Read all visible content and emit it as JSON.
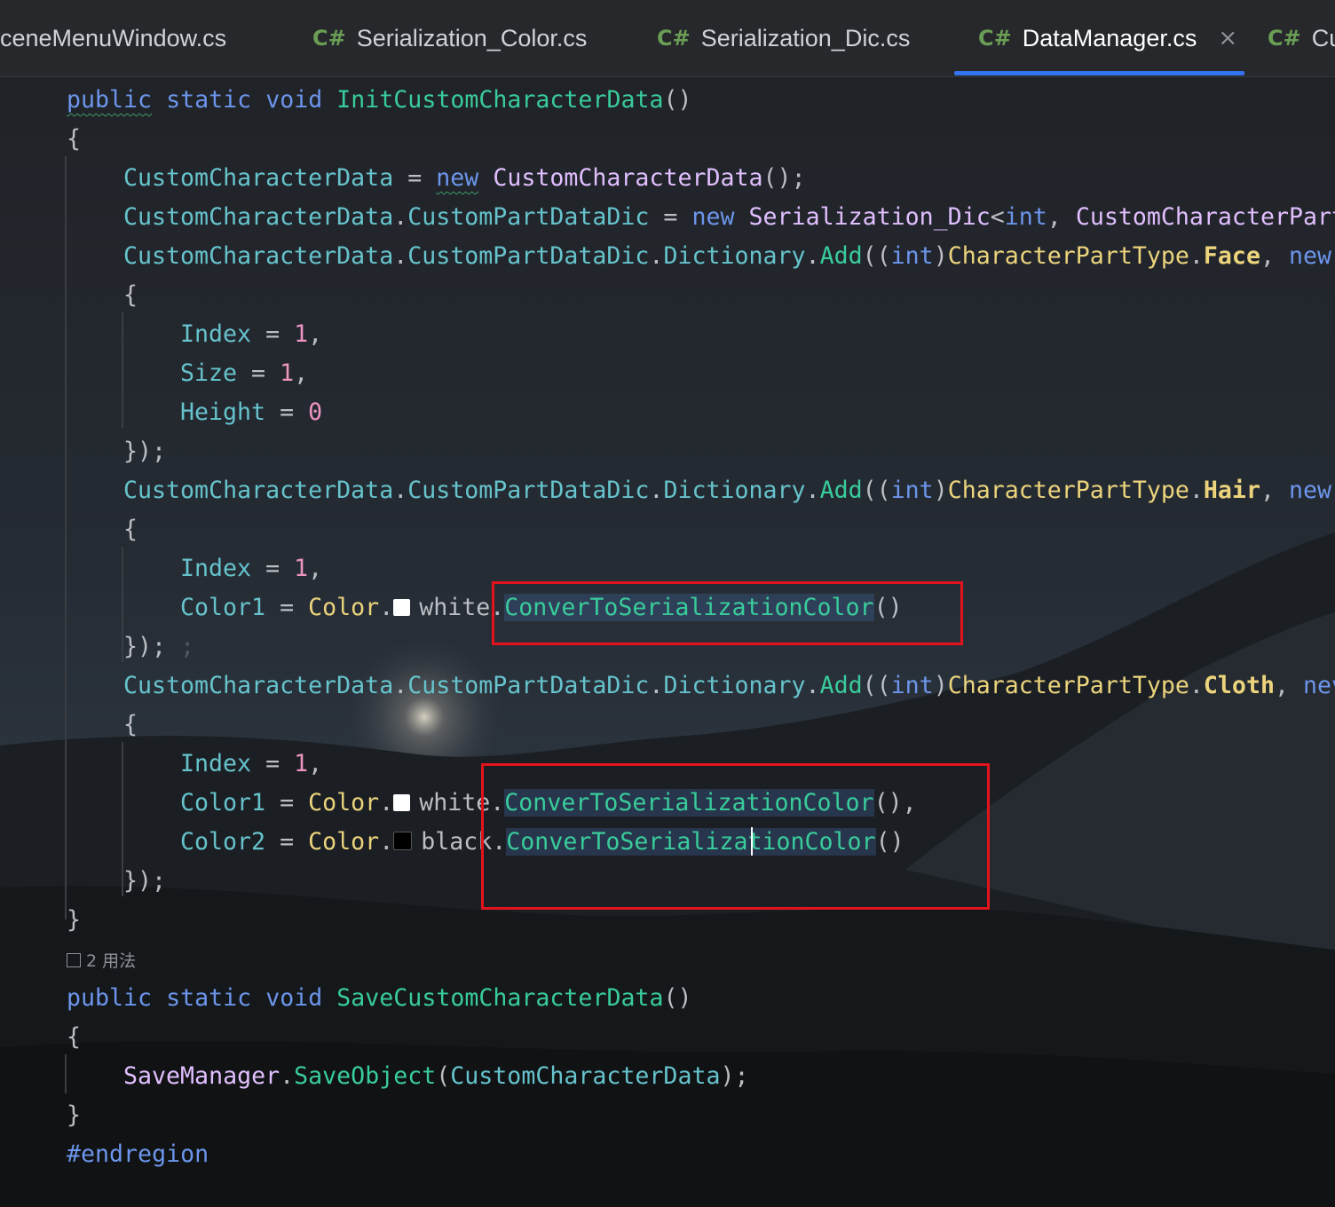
{
  "tabs": [
    {
      "label": "ceneMenuWindow.cs",
      "lang": "",
      "active": false
    },
    {
      "label": "Serialization_Color.cs",
      "lang": "C#",
      "active": false
    },
    {
      "label": "Serialization_Dic.cs",
      "lang": "C#",
      "active": false
    },
    {
      "label": "DataManager.cs",
      "lang": "C#",
      "active": true
    },
    {
      "label": "Cus",
      "lang": "C#",
      "active": false
    }
  ],
  "close_glyph": "×",
  "usage_hint": "2 用法",
  "code": {
    "m1_public": "public",
    "m1_static": "static",
    "m1_void": "void",
    "m1_name": "InitCustomCharacterData",
    "parens": "()",
    "open_brace": "{",
    "close_brace": "}",
    "close_call": "});",
    "close_call_extra": ";",
    "l3_var": "CustomCharacterData",
    "l3_eq": " = ",
    "l3_new": "new",
    "l3_type": "CustomCharacterData",
    "l3_tail": "();",
    "l4_a": "CustomCharacterData",
    "dot": ".",
    "l4_b": "CustomPartDataDic",
    "l4_eq": " = ",
    "l4_new": "new",
    "l4_type": "Serialization_Dic",
    "l4_lt": "<",
    "l4_int": "int",
    "l4_comma": ", ",
    "l4_type2": "CustomCharacterPart",
    "add_dict": "Dictionary",
    "add_fn": "Add",
    "add_open": "((",
    "add_int": "int",
    "add_close": ")",
    "enum_type": "CharacterPartType",
    "enum_face": "Face",
    "enum_hair": "Hair",
    "enum_cloth": "Cloth",
    "comma_sp": ", ",
    "new_kw": "new",
    "new_kw_cut": "nev",
    "index_field": "Index",
    "size_field": "Size",
    "height_field": "Height",
    "color1_field": "Color1",
    "color2_field": "Color2",
    "assign": " = ",
    "one": "1",
    "zero": "0",
    "comma": ",",
    "color_cls": "Color",
    "white": "white",
    "black": "black",
    "conv_fn": "ConverToSerializationColor",
    "conv_tail_comma": "(),",
    "m2_name": "SaveCustomCharacterData",
    "save_cls": "SaveManager",
    "save_fn": "SaveObject",
    "save_open": "(",
    "save_arg": "CustomCharacterData",
    "save_close": ");",
    "endregion": "#endregion"
  },
  "colors": {
    "keyword": "#6c95eb",
    "method": "#39cc9b",
    "type": "#c191ff",
    "field": "#66c3cc",
    "enum": "#ecd47c",
    "number": "#ed94c0",
    "annotation_box": "#e3131b",
    "tab_accent": "#3574f0"
  }
}
